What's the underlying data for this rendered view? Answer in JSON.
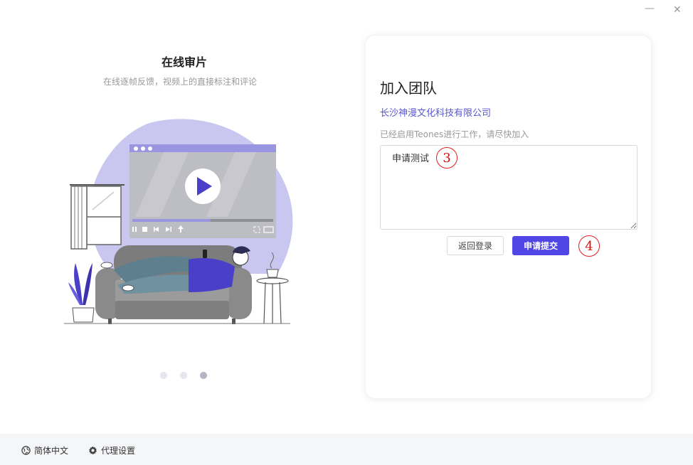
{
  "window": {
    "minimize_glyph": "—",
    "close_glyph": "✕"
  },
  "left": {
    "title": "在线审片",
    "subtitle": "在线逐帧反馈，视频上的直接标注和评论",
    "carousel_count": 3,
    "carousel_active": 3
  },
  "card": {
    "title": "加入团队",
    "company": "长沙神漫文化科技有限公司",
    "hint": "已经启用Teones进行工作，请尽快加入",
    "textarea_value": "申请测试",
    "back_label": "返回登录",
    "submit_label": "申请提交"
  },
  "annotations": [
    "3",
    "4"
  ],
  "footer": {
    "language_label": "简体中文",
    "proxy_label": "代理设置"
  },
  "icons": {
    "language": "globe-icon",
    "proxy": "gear-icon"
  },
  "colors": {
    "accent": "#4f46e5",
    "link": "#5b57d1",
    "annotation": "#e31b1b"
  }
}
